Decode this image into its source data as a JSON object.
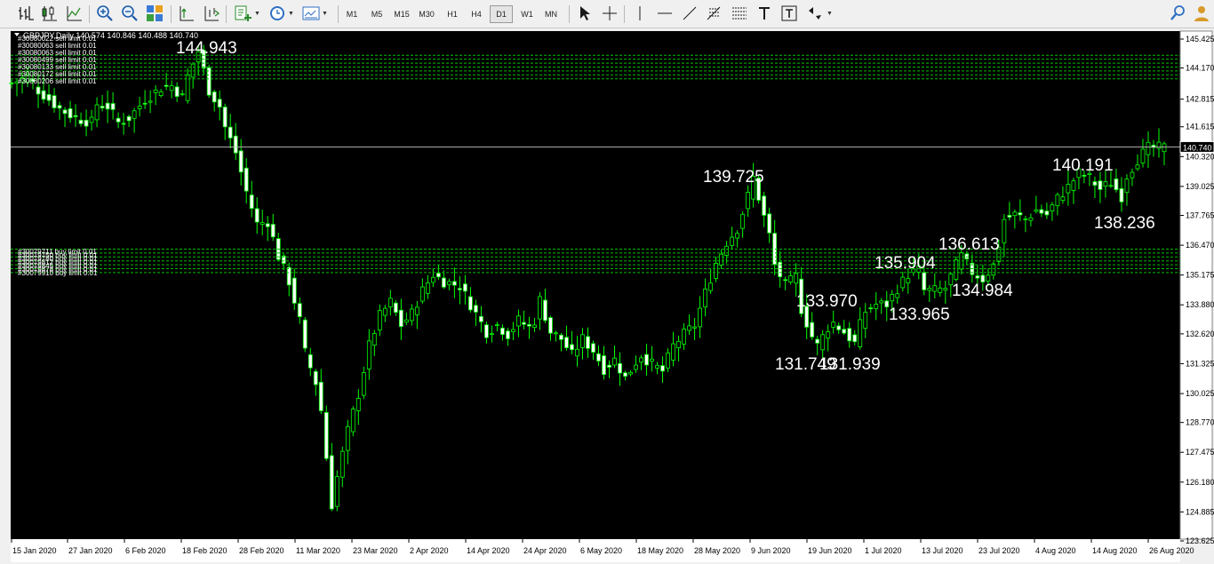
{
  "toolbar": {
    "timeframes": [
      "M1",
      "M5",
      "M15",
      "M30",
      "H1",
      "H4",
      "D1",
      "W1",
      "MN"
    ],
    "active_timeframe": "D1",
    "icons": [
      "bar-chart-icon",
      "candlestick-chart-icon",
      "line-chart-icon",
      "zoom-in-icon",
      "zoom-out-icon",
      "tile-windows-icon",
      "auto-scroll-icon",
      "chart-shift-icon",
      "new-order-icon",
      "clock-periodicity-icon",
      "templates-icon",
      "cursor-icon",
      "crosshair-icon",
      "vertical-line-icon",
      "horizontal-line-icon",
      "trendline-icon",
      "fibonacci-icon",
      "fibonacci-fan-icon",
      "text-icon",
      "text-label-icon",
      "arrows-icon",
      "search-icon",
      "account-icon"
    ]
  },
  "chart_header": {
    "symbol_line": "GBPJPY,Daily  140.574 140.846 140.488 140.740"
  },
  "order_labels": {
    "sell": [
      "#30080022 sell limit 0.01",
      "#30080063 sell limit 0.01",
      "#30080063 sell limit 0.01",
      "#30080499 sell limit 0.01",
      "#30080133 sell limit 0.01",
      "#30080172 sell limit 0.01",
      "#30080206 sell limit 0.01"
    ],
    "buy": [
      "#30079711 buy limit 0.01",
      "#30079750 buy limit 0.01",
      "#30079780 buy limit 0.01",
      "#30079812 buy limit 0.01",
      "#30079845 buy limit 0.01",
      "#30079878 buy limit 0.01",
      "#30079910 buy limit 0.01"
    ]
  },
  "colors": {
    "background": "#000000",
    "candle": "#00ff00",
    "bull_body": "#000000",
    "bear_body": "#ffffff",
    "grid": "#c0c0c0",
    "order_line": "#00c000",
    "price_line": "#c0c0c0",
    "text": "#ffffff"
  },
  "chart_data": {
    "type": "candlestick",
    "symbol": "GBPJPY",
    "timeframe": "Daily",
    "current_price": "140.740",
    "ylim": [
      123.625,
      145.425
    ],
    "y_ticks": [
      "145.425",
      "144.170",
      "142.815",
      "141.615",
      "140.320",
      "139.025",
      "137.765",
      "136.470",
      "135.175",
      "133.880",
      "132.620",
      "131.325",
      "130.025",
      "128.770",
      "127.475",
      "126.180",
      "124.885",
      "123.625"
    ],
    "x_ticks": [
      "15 Jan 2020",
      "27 Jan 2020",
      "6 Feb 2020",
      "18 Feb 2020",
      "28 Feb 2020",
      "11 Mar 2020",
      "23 Mar 2020",
      "2 Apr 2020",
      "14 Apr 2020",
      "24 Apr 2020",
      "6 May 2020",
      "18 May 2020",
      "28 May 2020",
      "9 Jun 2020",
      "19 Jun 2020",
      "1 Jul 2020",
      "13 Jul 2020",
      "23 Jul 2020",
      "4 Aug 2020",
      "14 Aug 2020",
      "26 Aug 2020"
    ],
    "sell_limit_levels": [
      144.72,
      144.55,
      144.38,
      144.21,
      144.04,
      143.87,
      143.7
    ],
    "buy_limit_levels": [
      136.3,
      136.13,
      135.96,
      135.79,
      135.62,
      135.45,
      135.28
    ],
    "annotations": [
      {
        "text": "144.943",
        "value": 144.943
      },
      {
        "text": "139.725",
        "value": 139.725
      },
      {
        "text": "133.970",
        "value": 133.97
      },
      {
        "text": "131.749",
        "value": 131.749
      },
      {
        "text": "131.939",
        "value": 131.939
      },
      {
        "text": "133.965",
        "value": 133.965
      },
      {
        "text": "135.904",
        "value": 135.904
      },
      {
        "text": "136.613",
        "value": 136.613
      },
      {
        "text": "134.984",
        "value": 134.984
      },
      {
        "text": "140.191",
        "value": 140.191
      },
      {
        "text": "138.236",
        "value": 138.236
      }
    ],
    "path_points": [
      [
        0,
        143.5
      ],
      [
        3,
        143.8
      ],
      [
        5,
        143.2
      ],
      [
        9,
        142.4
      ],
      [
        12,
        142.0
      ],
      [
        15,
        141.8
      ],
      [
        16,
        142.6
      ],
      [
        18,
        142.5
      ],
      [
        20,
        141.8
      ],
      [
        22,
        142.0
      ],
      [
        25,
        142.8
      ],
      [
        28,
        143.3
      ],
      [
        30,
        143.4
      ],
      [
        32,
        142.9
      ],
      [
        33,
        143.8
      ],
      [
        35,
        144.9
      ],
      [
        37,
        143.2
      ],
      [
        39,
        142.5
      ],
      [
        40,
        141.6
      ],
      [
        42,
        140.5
      ],
      [
        44,
        138.8
      ],
      [
        46,
        137.4
      ],
      [
        48,
        137.5
      ],
      [
        50,
        136.0
      ],
      [
        52,
        134.9
      ],
      [
        54,
        133.2
      ],
      [
        55,
        131.8
      ],
      [
        57,
        130.5
      ],
      [
        58,
        129.3
      ],
      [
        60,
        125.2
      ],
      [
        61,
        126.4
      ],
      [
        63,
        128.4
      ],
      [
        65,
        130.0
      ],
      [
        67,
        132.1
      ],
      [
        69,
        133.4
      ],
      [
        71,
        134.0
      ],
      [
        73,
        133.0
      ],
      [
        75,
        133.5
      ],
      [
        77,
        134.5
      ],
      [
        79,
        135.2
      ],
      [
        81,
        134.9
      ],
      [
        84,
        134.7
      ],
      [
        86,
        133.9
      ],
      [
        88,
        133.1
      ],
      [
        89,
        132.7
      ],
      [
        91,
        133.0
      ],
      [
        93,
        132.6
      ],
      [
        95,
        133.2
      ],
      [
        97,
        132.9
      ],
      [
        98,
        133.2
      ],
      [
        99,
        134.1
      ],
      [
        101,
        132.7
      ],
      [
        103,
        132.4
      ],
      [
        105,
        131.7
      ],
      [
        107,
        132.4
      ],
      [
        109,
        131.9
      ],
      [
        111,
        131.1
      ],
      [
        113,
        131.5
      ],
      [
        115,
        130.7
      ],
      [
        117,
        131.4
      ],
      [
        118,
        131.7
      ],
      [
        120,
        131.3
      ],
      [
        122,
        131.0
      ],
      [
        124,
        132.1
      ],
      [
        126,
        132.6
      ],
      [
        128,
        133.0
      ],
      [
        130,
        134.4
      ],
      [
        132,
        135.7
      ],
      [
        134,
        136.6
      ],
      [
        136,
        137.2
      ],
      [
        138,
        138.6
      ],
      [
        139,
        139.4
      ],
      [
        141,
        137.7
      ],
      [
        142,
        136.9
      ],
      [
        143,
        135.6
      ],
      [
        145,
        134.7
      ],
      [
        147,
        135.1
      ],
      [
        148,
        133.7
      ],
      [
        150,
        132.5
      ],
      [
        151,
        132.1
      ],
      [
        153,
        132.9
      ],
      [
        154,
        133.1
      ],
      [
        156,
        132.7
      ],
      [
        158,
        132.2
      ],
      [
        159,
        133.0
      ],
      [
        160,
        133.6
      ],
      [
        162,
        133.9
      ],
      [
        164,
        133.9
      ],
      [
        166,
        134.6
      ],
      [
        168,
        135.2
      ],
      [
        170,
        135.4
      ],
      [
        171,
        134.5
      ],
      [
        173,
        134.5
      ],
      [
        175,
        134.6
      ],
      [
        177,
        135.6
      ],
      [
        178,
        136.0
      ],
      [
        180,
        135.3
      ],
      [
        182,
        135.0
      ],
      [
        184,
        135.6
      ],
      [
        185,
        136.5
      ],
      [
        186,
        137.6
      ],
      [
        188,
        137.8
      ],
      [
        190,
        137.6
      ],
      [
        192,
        138.0
      ],
      [
        194,
        137.8
      ],
      [
        196,
        138.5
      ],
      [
        198,
        139.0
      ],
      [
        200,
        139.6
      ],
      [
        202,
        139.4
      ],
      [
        204,
        138.9
      ],
      [
        206,
        139.2
      ],
      [
        208,
        138.6
      ],
      [
        209,
        139.5
      ],
      [
        211,
        140.2
      ],
      [
        213,
        140.7
      ]
    ]
  }
}
